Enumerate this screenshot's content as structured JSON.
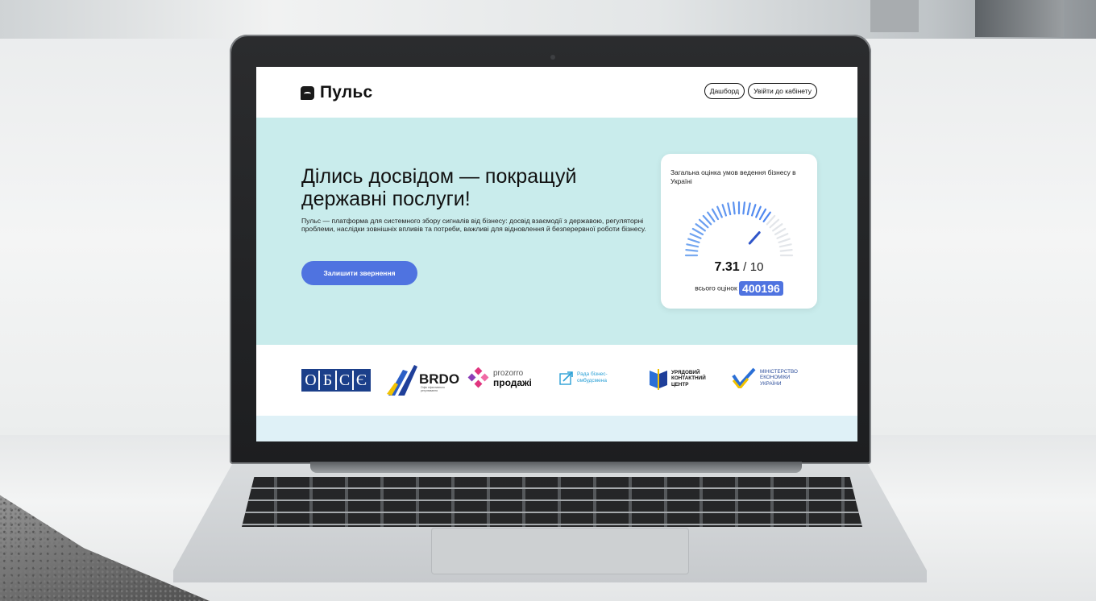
{
  "header": {
    "logo_text": "Пульс",
    "nav": {
      "dashboard": "Дашборд",
      "login": "Увійти до кабінету"
    }
  },
  "hero": {
    "title": "Ділись досвідом — покращуй державні послуги!",
    "description": "Пульс — платформа для системного збору сигналів від бізнесу: досвід взаємодії з державою, регуляторні проблеми, наслідки зовнішніх впливів та потреби, важливі для відновлення й безперервної роботи бізнесу.",
    "cta_label": "Залишити звернення"
  },
  "rating_card": {
    "title": "Загальна оцінка умов ведення бізнесу в Україні",
    "score": "7.31",
    "separator": "/",
    "max": "10",
    "count_label": "всього оцінок",
    "count": "400196",
    "gauge_fraction": 0.731
  },
  "partners": {
    "osce_letters": [
      "О",
      "Б",
      "С",
      "Є"
    ],
    "brdo": {
      "name": "BRDO",
      "subtitle": "Офіс ефективного регулювання"
    },
    "prozorro": {
      "line1": "prozorro",
      "line2": "продажі"
    },
    "rada": {
      "line1": "Рада бізнес-",
      "line2": "омбудсмена"
    },
    "contact_center": {
      "line1": "УРЯДОВИЙ",
      "line2": "КОНТАКТНИЙ",
      "line3": "ЦЕНТР"
    },
    "ministry": {
      "line1": "МІНІСТЕРСТВО",
      "line2": "ЕКОНОМІКИ",
      "line3": "УКРАЇНИ"
    }
  },
  "colors": {
    "hero_bg": "#c9ecec",
    "accent": "#4f73e0",
    "footer_strip": "#dff1f7"
  }
}
